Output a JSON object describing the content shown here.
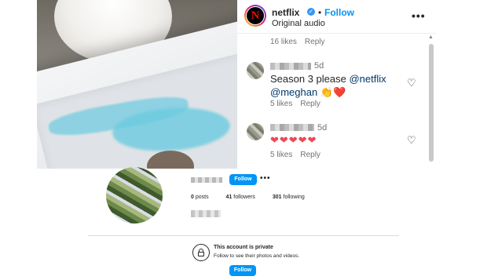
{
  "post": {
    "username": "netflix",
    "follow_label": "Follow",
    "separator": "•",
    "audio": "Original audio",
    "more": "•••"
  },
  "top_meta": {
    "likes": "16 likes",
    "reply": "Reply"
  },
  "comments": [
    {
      "time": "5d",
      "text": "Season 3 please ",
      "mention1": "@netflix",
      "mention2": "@meghan",
      "emoji": " 👏❤️",
      "likes": "5 likes",
      "reply": "Reply"
    },
    {
      "time": "5d",
      "hearts": "❤❤❤❤❤",
      "likes": "5 likes",
      "reply": "Reply"
    }
  ],
  "icons": {
    "heart": "♡",
    "verified": "✓",
    "scroll_up": "▲"
  },
  "profile": {
    "follow_label": "Follow",
    "more": "•••",
    "posts_count": "0",
    "posts_label": "posts",
    "followers_count": "41",
    "followers_label": "followers",
    "following_count": "301",
    "following_label": "following",
    "private_title": "This account is private",
    "private_sub": "Follow to see their photos and videos.",
    "bottom_follow_label": "Follow"
  },
  "colors": {
    "accent": "#0095f6",
    "like": "#ed4956",
    "brand": "#e50914"
  }
}
